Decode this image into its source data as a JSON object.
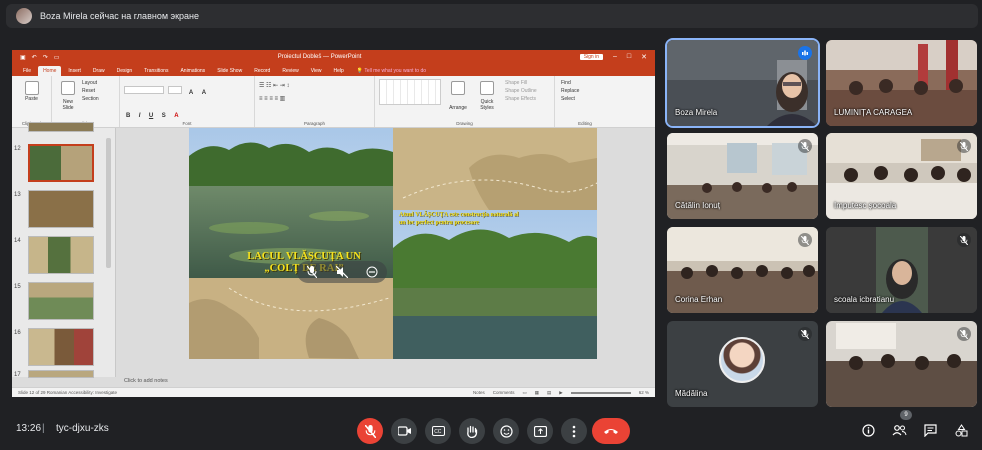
{
  "presenter_bar": {
    "text": "Boza Mirela сейчас на главном экране"
  },
  "powerpoint": {
    "window_title": "Proiectul Dobleš  —  PowerPoint",
    "sign_in": "Sign in",
    "tabs": [
      "File",
      "Home",
      "Insert",
      "Draw",
      "Design",
      "Transitions",
      "Animations",
      "Slide Show",
      "Record",
      "Review",
      "View",
      "Help"
    ],
    "active_tab": "Home",
    "tell_me": "Tell me what you want to do",
    "ribbon": {
      "paste": "Paste",
      "new_slide": "New Slide",
      "layout": "Layout",
      "reset": "Reset",
      "section": "Section",
      "arrange": "Arrange",
      "quick_styles": "Quick Styles",
      "shape_fill": "Shape Fill",
      "shape_outline": "Shape Outline",
      "shape_effects": "Shape Effects",
      "find": "Find",
      "replace": "Replace",
      "select": "Select",
      "groups": [
        "Clipboard",
        "Slides",
        "Font",
        "Paragraph",
        "Drawing",
        "Editing"
      ]
    },
    "thumbnails": [
      {
        "num": "12",
        "active": true
      },
      {
        "num": "13",
        "active": false
      },
      {
        "num": "14",
        "active": false
      },
      {
        "num": "15",
        "active": false
      },
      {
        "num": "16",
        "active": false
      },
      {
        "num": "17",
        "active": false
      }
    ],
    "slide": {
      "title": "LACUL VLĂȘCUȚA UN „COLȚ DE RAI”",
      "quote": "Atuul VLĂȘCUȚA este construcția naturală al un loc perfect pentru procesare"
    },
    "notes_placeholder": "Click to add notes",
    "status_left": "Slide 12 of 29     Romanian     Accessibility: Investigate",
    "status_notes": "Notes",
    "status_comments": "Comments",
    "status_zoom": "62 %"
  },
  "participants": [
    {
      "name": "Boza Mirela",
      "mic": "active"
    },
    {
      "name": "LUMINIȚA CARAGEA",
      "mic": "none"
    },
    {
      "name": "Cătălin Ionuț",
      "mic": "muted"
    },
    {
      "name": "Imputesc șocoala",
      "mic": "muted"
    },
    {
      "name": "Corina Erhan",
      "mic": "muted"
    },
    {
      "name": "scoala icbratianu",
      "mic": "muted"
    },
    {
      "name": "Mădălina",
      "mic": "muted"
    },
    {
      "name": "",
      "mic": "muted"
    }
  ],
  "meeting": {
    "time": "13:26",
    "separator": "|",
    "code": "tyc-djxu-zks",
    "participant_count": "9"
  },
  "colors": {
    "background": "#202124",
    "ppt_accent": "#c43e1c",
    "end_call": "#ea4335",
    "speaking_outline": "#8ab4f8"
  }
}
